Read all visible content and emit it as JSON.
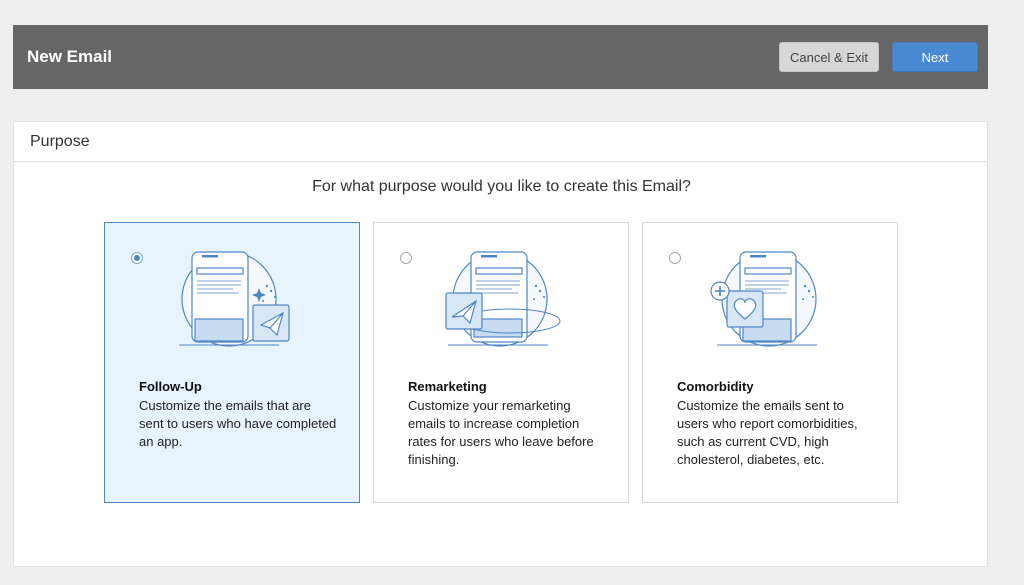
{
  "header": {
    "title": "New Email",
    "cancel_label": "Cancel & Exit",
    "next_label": "Next"
  },
  "panel": {
    "title": "Purpose",
    "question": "For what purpose would you like to create this Email?"
  },
  "options": [
    {
      "title": "Follow-Up",
      "description": "Customize the emails that are sent to users who have completed an app.",
      "selected": true,
      "icon": "paper-plane-icon"
    },
    {
      "title": "Remarketing",
      "description": "Customize your remarketing emails to increase completion rates for users who leave before finishing.",
      "selected": false,
      "icon": "paper-plane-orbit-icon"
    },
    {
      "title": "Comorbidity",
      "description": "Customize the emails sent to users who report comorbidities, such as current CVD, high cholesterol, diabetes, etc.",
      "selected": false,
      "icon": "heart-plus-icon"
    }
  ],
  "colors": {
    "header_bg": "#666666",
    "next_bg": "#4a8ad4",
    "selected_bg": "#e7f3fd",
    "selected_border": "#4f86c6",
    "illustration_stroke": "#4f86c6"
  }
}
